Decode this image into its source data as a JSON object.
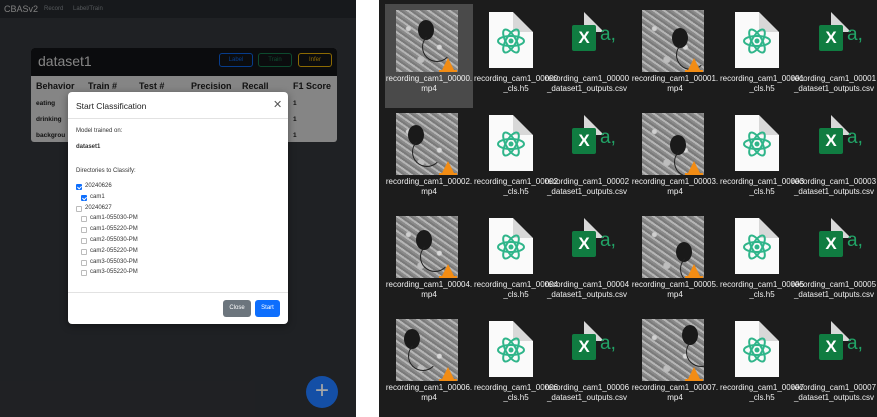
{
  "app": {
    "brand": "CBASv2",
    "nav": [
      "Record",
      "Label/Train"
    ]
  },
  "dataset_card": {
    "title": "dataset1",
    "buttons": [
      "Label",
      "Train",
      "Infer"
    ],
    "columns": [
      "Behavior",
      "Train #",
      "Test #",
      "Precision",
      "Recall",
      "F1 Score"
    ],
    "rows": [
      {
        "behavior": "eating",
        "f1": "1"
      },
      {
        "behavior": "drinking",
        "f1": "1"
      },
      {
        "behavior": "backgrou",
        "f1": "1"
      }
    ]
  },
  "modal": {
    "title": "Start Classification",
    "trained_on_label": "Model trained on:",
    "trained_on_value": "dataset1",
    "dirs_label": "Directories to Classify:",
    "tree": [
      {
        "label": "20240626",
        "checked": true,
        "indent": 0
      },
      {
        "label": "cam1",
        "checked": true,
        "indent": 1
      },
      {
        "label": "20240627",
        "checked": false,
        "indent": 0
      },
      {
        "label": "cam1-055030-PM",
        "checked": false,
        "indent": 1
      },
      {
        "label": "cam1-055220-PM",
        "checked": false,
        "indent": 1
      },
      {
        "label": "cam2-055030-PM",
        "checked": false,
        "indent": 1
      },
      {
        "label": "cam2-055220-PM",
        "checked": false,
        "indent": 1
      },
      {
        "label": "cam3-055030-PM",
        "checked": false,
        "indent": 1
      },
      {
        "label": "cam3-055220-PM",
        "checked": false,
        "indent": 1
      }
    ],
    "close_button": "Close",
    "start_button": "Start"
  },
  "fab_label": "+",
  "files": [
    {
      "name": "recording_cam1_00000.mp4",
      "type": "video"
    },
    {
      "name": "recording_cam1_00000_cls.h5",
      "type": "h5"
    },
    {
      "name": "recording_cam1_00000_dataset1_outputs.csv",
      "type": "csv"
    },
    {
      "name": "recording_cam1_00001.mp4",
      "type": "video"
    },
    {
      "name": "recording_cam1_00001_cls.h5",
      "type": "h5"
    },
    {
      "name": "recording_cam1_00001_dataset1_outputs.csv",
      "type": "csv"
    },
    {
      "name": "recording_cam1_00002.mp4",
      "type": "video"
    },
    {
      "name": "recording_cam1_00002_cls.h5",
      "type": "h5"
    },
    {
      "name": "recording_cam1_00002_dataset1_outputs.csv",
      "type": "csv"
    },
    {
      "name": "recording_cam1_00003.mp4",
      "type": "video"
    },
    {
      "name": "recording_cam1_00003_cls.h5",
      "type": "h5"
    },
    {
      "name": "recording_cam1_00003_dataset1_outputs.csv",
      "type": "csv"
    },
    {
      "name": "recording_cam1_00004.mp4",
      "type": "video"
    },
    {
      "name": "recording_cam1_00004_cls.h5",
      "type": "h5"
    },
    {
      "name": "recording_cam1_00004_dataset1_outputs.csv",
      "type": "csv"
    },
    {
      "name": "recording_cam1_00005.mp4",
      "type": "video"
    },
    {
      "name": "recording_cam1_00005_cls.h5",
      "type": "h5"
    },
    {
      "name": "recording_cam1_00005_dataset1_outputs.csv",
      "type": "csv"
    },
    {
      "name": "recording_cam1_00006.mp4",
      "type": "video"
    },
    {
      "name": "recording_cam1_00006_cls.h5",
      "type": "h5"
    },
    {
      "name": "recording_cam1_00006_dataset1_outputs.csv",
      "type": "csv"
    },
    {
      "name": "recording_cam1_00007.mp4",
      "type": "video"
    },
    {
      "name": "recording_cam1_00007_cls.h5",
      "type": "h5"
    },
    {
      "name": "recording_cam1_00007_dataset1_outputs.csv",
      "type": "csv"
    }
  ],
  "colors": {
    "primary": "#0d6efd",
    "secondary": "#6c757d",
    "excel": "#107c41",
    "h5_icon": "#2fb58a",
    "vlc": "#f28c14"
  }
}
